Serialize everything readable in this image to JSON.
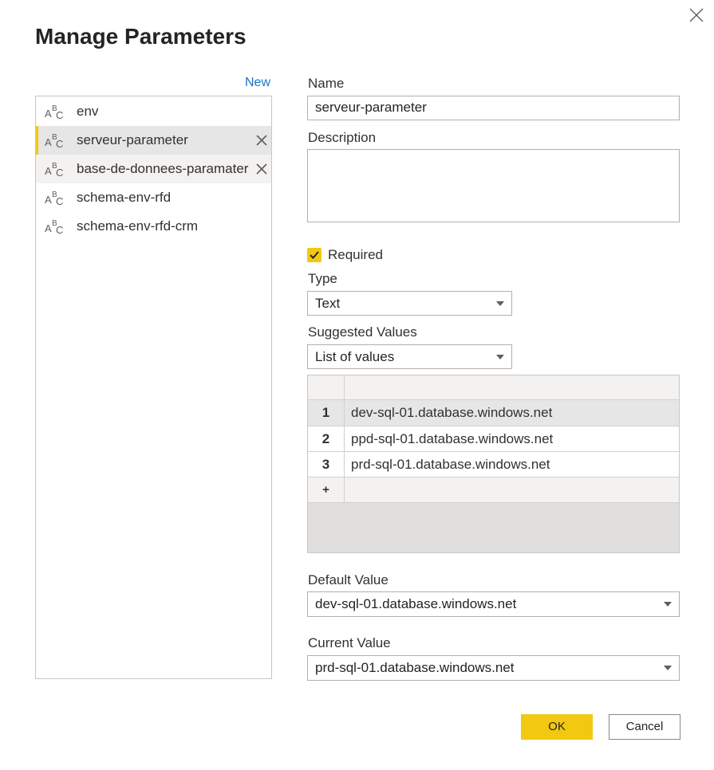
{
  "dialog": {
    "title": "Manage Parameters"
  },
  "sidebar": {
    "new_label": "New",
    "items": [
      {
        "label": "env",
        "icon": "abc-text-icon"
      },
      {
        "label": "serveur-parameter",
        "icon": "abc-text-icon",
        "selected": true
      },
      {
        "label": "base-de-donnees-paramater",
        "icon": "abc-text-icon"
      },
      {
        "label": "schema-env-rfd",
        "icon": "abc-text-icon"
      },
      {
        "label": "schema-env-rfd-crm",
        "icon": "abc-text-icon"
      }
    ]
  },
  "form": {
    "name_label": "Name",
    "name_value": "serveur-parameter",
    "description_label": "Description",
    "description_value": "",
    "required_label": "Required",
    "required_checked": true,
    "type_label": "Type",
    "type_value": "Text",
    "suggested_label": "Suggested Values",
    "suggested_value": "List of values",
    "values_table": {
      "rows": [
        {
          "num": "1",
          "value": "dev-sql-01.database.windows.net"
        },
        {
          "num": "2",
          "value": "ppd-sql-01.database.windows.net"
        },
        {
          "num": "3",
          "value": "prd-sql-01.database.windows.net"
        }
      ],
      "add_row_symbol": "+"
    },
    "default_label": "Default Value",
    "default_value": "dev-sql-01.database.windows.net",
    "current_label": "Current Value",
    "current_value": "prd-sql-01.database.windows.net"
  },
  "buttons": {
    "ok": "OK",
    "cancel": "Cancel"
  },
  "colors": {
    "accent": "#f2c811",
    "link": "#1a73c8"
  }
}
